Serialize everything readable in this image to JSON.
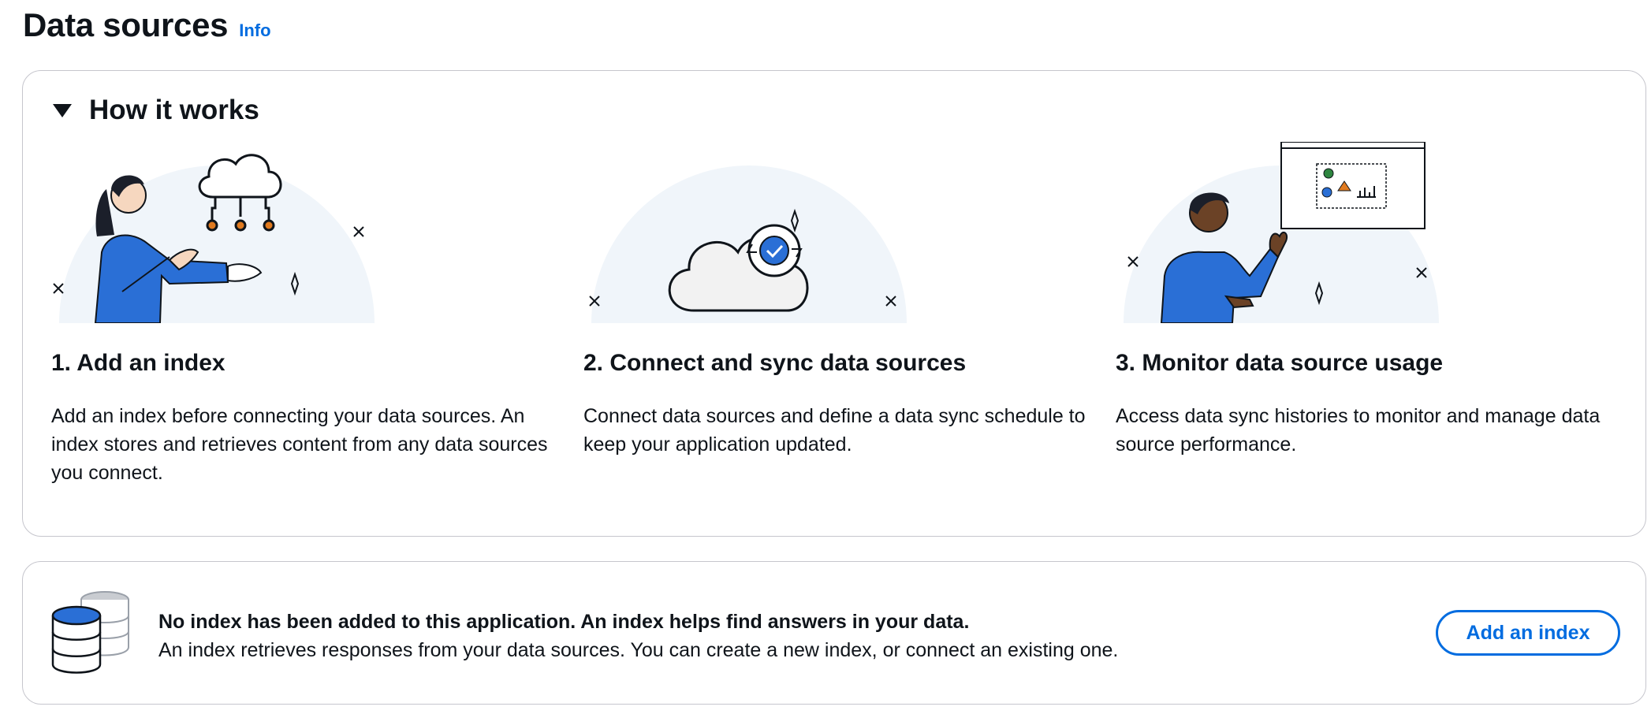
{
  "header": {
    "title": "Data sources",
    "info_label": "Info"
  },
  "how_it_works": {
    "title": "How it works",
    "steps": [
      {
        "title": "1. Add an index",
        "description": "Add an index before connecting your data sources. An index stores and retrieves content from any data sources you connect."
      },
      {
        "title": "2. Connect and sync data sources",
        "description": "Connect data sources and define a data sync schedule to keep your application updated."
      },
      {
        "title": "3. Monitor data source usage",
        "description": "Access data sync histories to monitor and manage data source performance."
      }
    ]
  },
  "index_alert": {
    "heading": "No index has been added to this application. An index helps find answers in your data.",
    "subtext": "An index retrieves responses from your data sources. You can create a new index, or connect an existing one.",
    "button_label": "Add an index"
  },
  "colors": {
    "accent": "#006ce0",
    "illustration_blue": "#2a6fd6",
    "card_border": "#c6c6cd",
    "illustration_bg": "#f0f5fa"
  },
  "icons": [
    "caret-down-icon",
    "cloud-network-icon",
    "cloud-sync-icon",
    "dashboard-window-icon",
    "database-stack-icon"
  ]
}
